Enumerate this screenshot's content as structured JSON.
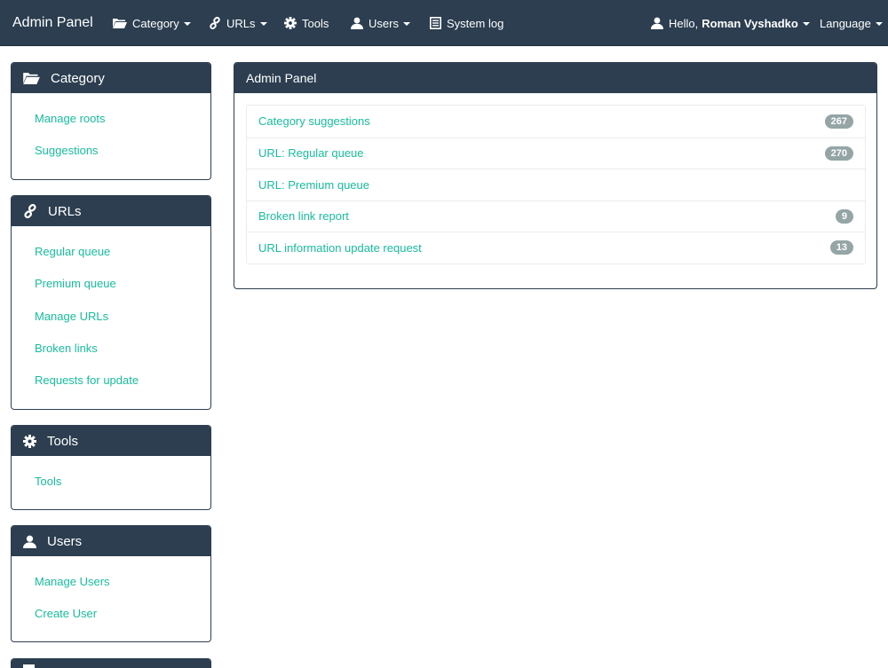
{
  "navbar": {
    "brand": "Admin Panel",
    "items": [
      {
        "label": "Category",
        "icon": "folder-open-icon",
        "dropdown": true
      },
      {
        "label": "URLs",
        "icon": "link-icon",
        "dropdown": true
      },
      {
        "label": "Tools",
        "icon": "gear-icon",
        "dropdown": false
      },
      {
        "label": "Users",
        "icon": "user-icon",
        "dropdown": true
      },
      {
        "label": "System log",
        "icon": "list-alt-icon",
        "dropdown": false
      }
    ],
    "user_greeting": "Hello,",
    "user_name": "Roman Vyshadko",
    "language": "Language"
  },
  "sidebar": {
    "category": {
      "title": "Category",
      "links": [
        "Manage roots",
        "Suggestions"
      ]
    },
    "urls": {
      "title": "URLs",
      "links": [
        "Regular queue",
        "Premium queue",
        "Manage URLs",
        "Broken links",
        "Requests for update"
      ]
    },
    "tools": {
      "title": "Tools",
      "links": [
        "Tools"
      ]
    },
    "users": {
      "title": "Users",
      "links": [
        "Manage Users",
        "Create User"
      ]
    }
  },
  "main": {
    "title": "Admin Panel",
    "rows": [
      {
        "label": "Category suggestions",
        "count": "267"
      },
      {
        "label": "URL: Regular queue",
        "count": "270"
      },
      {
        "label": "URL: Premium queue",
        "count": ""
      },
      {
        "label": "Broken link report",
        "count": "9"
      },
      {
        "label": "URL information update request",
        "count": "13"
      }
    ]
  },
  "colors": {
    "navbar": "#2c3e50",
    "link": "#18bc9c",
    "badge": "#95a5a6"
  }
}
